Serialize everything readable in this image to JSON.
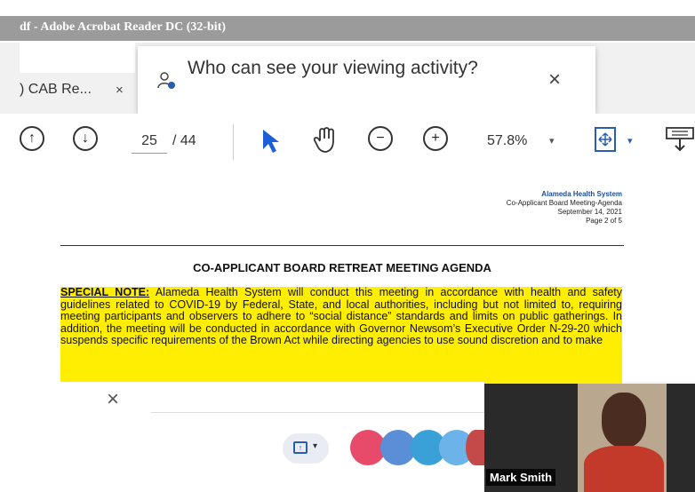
{
  "window": {
    "title": "df - Adobe Acrobat Reader DC (32-bit)"
  },
  "tab": {
    "label": ") CAB Re...",
    "close": "×"
  },
  "popup": {
    "text": "Who can see your viewing activity?",
    "close": "×"
  },
  "toolbar": {
    "page_current": "25",
    "page_total": "/ 44",
    "zoom": "57.8%",
    "zoom_caret": "▾",
    "fit_caret": "▾"
  },
  "document": {
    "header_org": "Alameda Health System",
    "header_line2": "Co-Applicant Board Meeting-Agenda",
    "header_line3": "September 14, 2021",
    "header_line4": "Page 2 of 5",
    "title": "CO-APPLICANT BOARD RETREAT MEETING AGENDA",
    "note_label": "SPECIAL NOTE:",
    "note_text": " Alameda Health System will conduct this meeting in accordance with health and safety guidelines related to COVID-19 by Federal, State, and local authorities, including but not limited to, requiring meeting participants and observers to adhere to “social distance” standards and limits on public gatherings. In addition, the meeting will be conducted in accordance with Governor Newsom’s Executive Order N-29-20 which suspends specific requirements of the Brown Act while directing agencies to use sound discretion and to make"
  },
  "notification": {
    "close": "×"
  },
  "video": {
    "participant_name": "Mark Smith"
  },
  "colors": {
    "accent": "#2a5db0",
    "highlight": "#ffee00"
  }
}
